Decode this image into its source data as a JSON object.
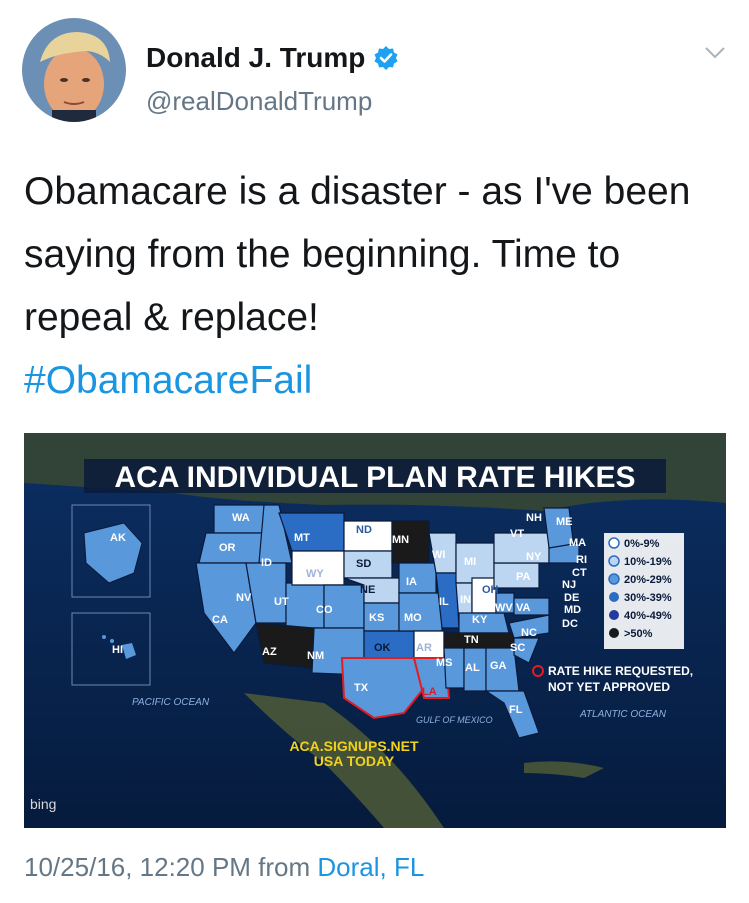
{
  "author": {
    "name": "Donald J. Trump",
    "handle": "@realDonaldTrump",
    "verified": true
  },
  "tweet": {
    "lines": [
      "Obamacare is a disaster - as I've been",
      "saying from the beginning. Time to",
      "repeal & replace!"
    ],
    "hashtag": "#ObamacareFail"
  },
  "media": {
    "title": "ACA INDIVIDUAL PLAN RATE HIKES",
    "legend": [
      {
        "label": "0%-9%",
        "color": "#ffffff"
      },
      {
        "label": "10%-19%",
        "color": "#bcd6f2"
      },
      {
        "label": "20%-29%",
        "color": "#5a98dc"
      },
      {
        "label": "30%-39%",
        "color": "#2b6cc4"
      },
      {
        "label": "40%-49%",
        "color": "#243a9e"
      },
      {
        "label": ">50%",
        "color": "#1a1a1a"
      }
    ],
    "note": [
      "RATE HIKE REQUESTED,",
      "NOT YET APPROVED"
    ],
    "pacific": "PACIFIC OCEAN",
    "atlantic": "ATLANTIC OCEAN",
    "gulf": "GULF OF MEXICO",
    "source": [
      "ACA.SIGNUPS.NET",
      "USA TODAY"
    ],
    "bing": "bing",
    "states": [
      "WA",
      "OR",
      "CA",
      "ID",
      "NV",
      "MT",
      "WY",
      "UT",
      "AZ",
      "CO",
      "NM",
      "ND",
      "SD",
      "NE",
      "KS",
      "OK",
      "TX",
      "MN",
      "IA",
      "MO",
      "AR",
      "LA",
      "WI",
      "IL",
      "MI",
      "IN",
      "OH",
      "KY",
      "TN",
      "MS",
      "AL",
      "GA",
      "FL",
      "SC",
      "NC",
      "VA",
      "WV",
      "PA",
      "NY",
      "VT",
      "NH",
      "ME",
      "MA",
      "RI",
      "CT",
      "NJ",
      "DE",
      "MD",
      "DC",
      "AK",
      "HI"
    ]
  },
  "footer": {
    "timestamp": "10/25/16, 12:20 PM from ",
    "location": "Doral, FL"
  }
}
